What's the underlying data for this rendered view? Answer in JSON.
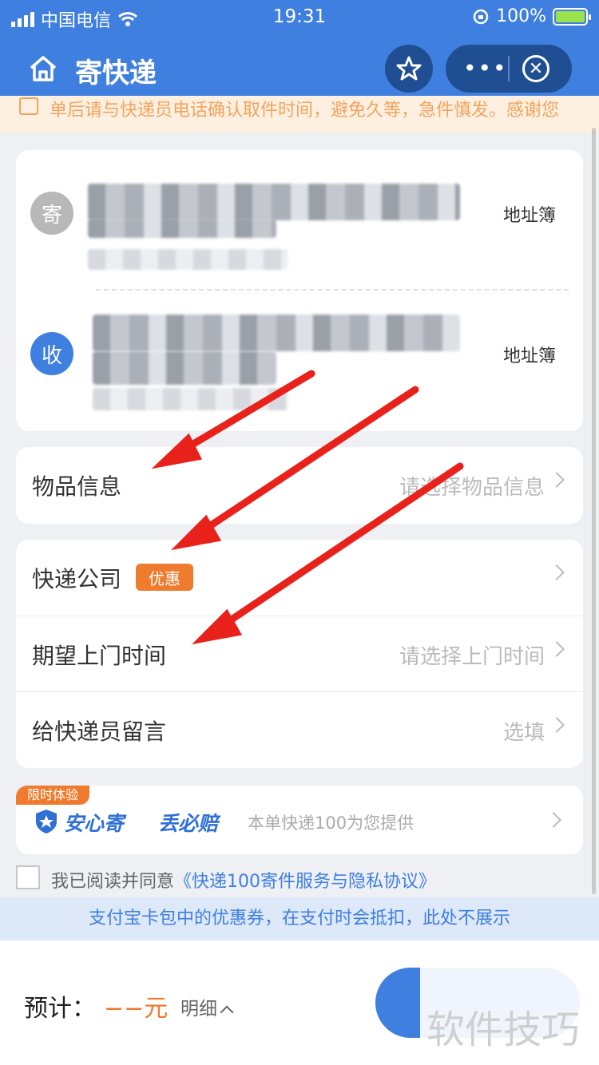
{
  "status_bar": {
    "carrier": "中国电信",
    "time": "19:31",
    "battery": "100%"
  },
  "nav": {
    "title": "寄快递",
    "home_icon": "home-icon",
    "star_icon": "star-icon",
    "more_icon": "more-icon",
    "close_icon": "close-circle-icon"
  },
  "notice": "单后请与快递员电话确认取件时间，避免久等，急件慎发。感谢您",
  "address": {
    "sender_badge": "寄",
    "receiver_badge": "收",
    "sender_book": "地址簿",
    "receiver_book": "地址簿"
  },
  "item_info": {
    "label": "物品信息",
    "value": "请选择物品信息"
  },
  "courier": {
    "label": "快递公司",
    "promo": "优惠"
  },
  "pickup_time": {
    "label": "期望上门时间",
    "value": "请选择上门时间"
  },
  "message": {
    "label": "给快递员留言",
    "value": "选填"
  },
  "insurance": {
    "tag": "限时体验",
    "brand1": "安心寄",
    "brand2": "丢必赔",
    "desc": "本单快递100为您提供"
  },
  "agreement": {
    "prefix": "我已阅读并同意",
    "link": "《快递100寄件服务与隐私协议》"
  },
  "tip": "支付宝卡包中的优惠券，在支付时会抵扣，此处不展示",
  "footer": {
    "estimate_label": "预计：",
    "price": "−−元",
    "detail": "明细"
  },
  "watermark": "软件技巧",
  "colors": {
    "brand_blue": "#3f7fe0",
    "accent_orange": "#ef7b2e",
    "annotation_red": "#e8221b"
  }
}
